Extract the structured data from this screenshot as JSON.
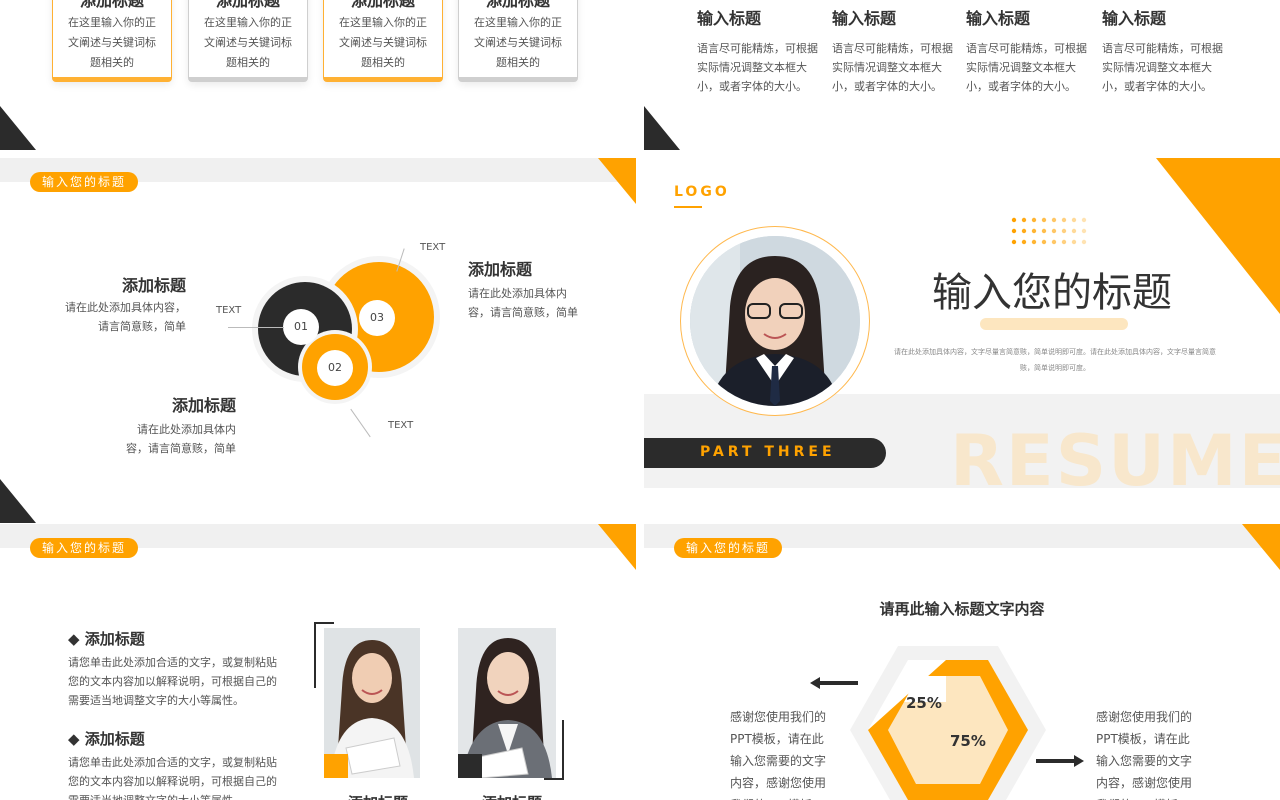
{
  "slide1": {
    "cards": [
      {
        "title": "添加标题",
        "text": "在这里输入你的正文阐述与关键词标题相关的",
        "style": "orange"
      },
      {
        "title": "添加标题",
        "text": "在这里输入你的正文阐述与关键词标题相关的",
        "style": "dark"
      },
      {
        "title": "添加标题",
        "text": "在这里输入你的正文阐述与关键词标题相关的",
        "style": "orange"
      },
      {
        "title": "添加标题",
        "text": "在这里输入你的正文阐述与关键词标题相关的",
        "style": "dark"
      }
    ]
  },
  "slide2": {
    "columns": [
      {
        "title": "输入标题",
        "text": "语言尽可能精炼，可根据实际情况调整文本框大小，或者字体的大小。"
      },
      {
        "title": "输入标题",
        "text": "语言尽可能精炼，可根据实际情况调整文本框大小，或者字体的大小。"
      },
      {
        "title": "输入标题",
        "text": "语言尽可能精炼，可根据实际情况调整文本框大小，或者字体的大小。"
      },
      {
        "title": "输入标题",
        "text": "语言尽可能精炼，可根据实际情况调整文本框大小，或者字体的大小。"
      }
    ]
  },
  "slide3": {
    "pill": "输入您的标题",
    "left_block": {
      "title": "添加标题",
      "text": "请在此处添加具体内容，请言简意赅，简单"
    },
    "right_block": {
      "title": "添加标题",
      "text": "请在此处添加具体内容，请言简意赅，简单"
    },
    "bottom_block": {
      "title": "添加标题",
      "text": "请在此处添加具体内容，请言简意赅，简单"
    },
    "circles": [
      "01",
      "03",
      "02"
    ],
    "text_labels": [
      "TEXT",
      "TEXT",
      "TEXT"
    ]
  },
  "slide4": {
    "logo": "LOGO",
    "title": "输入您的标题",
    "subtitle": "请在此处添加具体内容，文字尽量言简意赅，简单说明即可度。请在此处添加具体内容，文字尽量言简意赅，简单说明即可度。",
    "part": "PART THREE",
    "watermark": "RESUME"
  },
  "slide5": {
    "pill": "输入您的标题",
    "items": [
      {
        "title": "添加标题",
        "text": "请您单击此处添加合适的文字，或复制粘贴您的文本内容加以解释说明，可根据自己的需要适当地调整文字的大小等属性。"
      },
      {
        "title": "添加标题",
        "text": "请您单击此处添加合适的文字，或复制粘贴您的文本内容加以解释说明，可根据自己的需要适当地调整文字的大小等属性。"
      }
    ],
    "photo_captions": [
      "添加标题",
      "添加标题"
    ]
  },
  "slide6": {
    "pill": "输入您的标题",
    "title": "请再此输入标题文字内容",
    "left_text": "感谢您使用我们的PPT模板，请在此输入您需要的文字内容，感谢您使用我们的PPT模板。",
    "right_text": "感谢您使用我们的PPT模板，请在此输入您需要的文字内容，感谢您使用我们的PPT模板。",
    "stats": [
      {
        "label": "25%",
        "value": 0.25
      },
      {
        "label": "75%",
        "value": 0.75
      }
    ]
  },
  "colors": {
    "accent": "#ffa200",
    "dark": "#2b2b2b",
    "light": "#f0f0f0",
    "pale": "#fde6bf"
  }
}
